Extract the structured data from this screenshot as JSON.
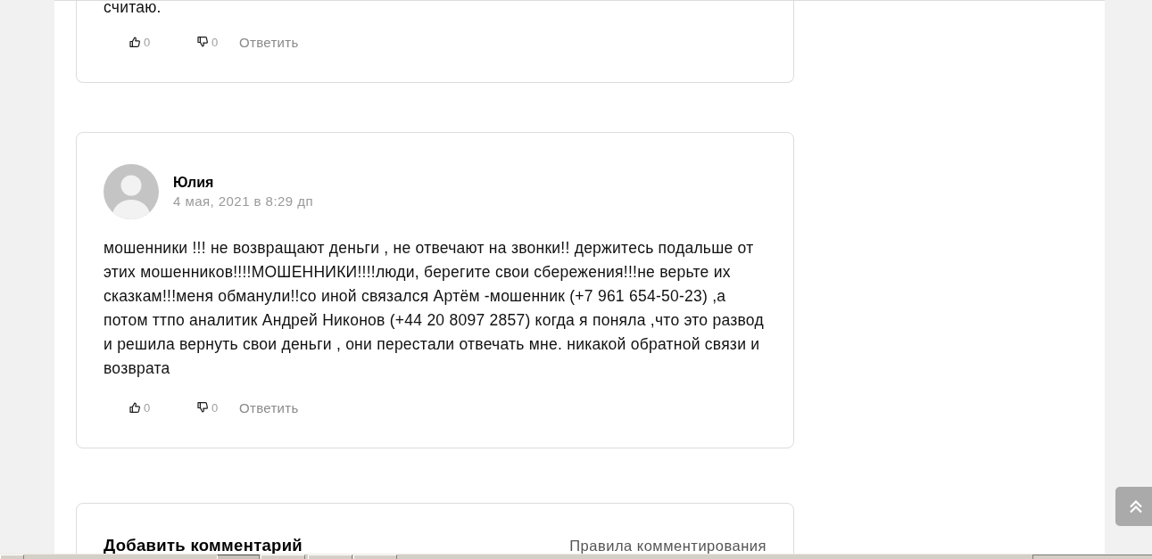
{
  "comments": [
    {
      "text": "считаю.",
      "likes": "0",
      "dislikes": "0",
      "reply": "Ответить"
    },
    {
      "author": "Юлия",
      "date": "4 мая, 2021 в 8:29 дп",
      "text": "мошенники !!! не возвращают деньги , не отвечают на звонки!! держитесь подальше от этих мошенников!!!!МОШЕННИКИ!!!!люди, берегите свои сбережения!!!не верьте их сказкам!!!меня обманули!!со иной связался Артём -мошенник (+7 961 654-50-23) ,а потом ттпо аналитик Андрей Никонов (+44 20 8097 2857) когда я поняла ,что это развод и решила вернуть свои деньги , они перестали отвечать мне. никакой обратной связи и возврата",
      "likes": "0",
      "dislikes": "0",
      "reply": "Ответить"
    }
  ],
  "comment_form": {
    "title": "Добавить комментарий",
    "rules_link": "Правила комментирования"
  }
}
